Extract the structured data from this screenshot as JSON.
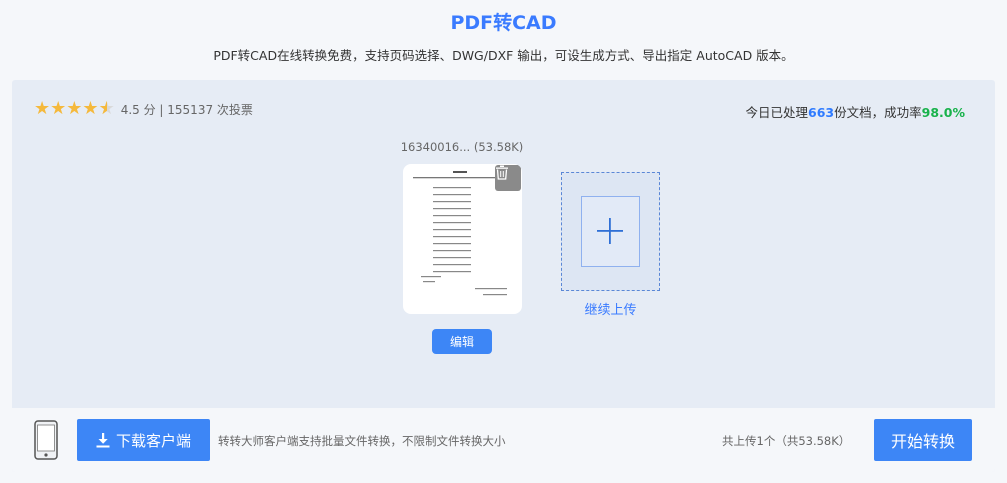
{
  "header": {
    "title": "PDF转CAD",
    "subtitle": "PDF转CAD在线转换免费，支持页码选择、DWG/DXF 输出，可设生成方式、导出指定 AutoCAD 版本。"
  },
  "rating": {
    "stars": 4.5,
    "text": "4.5 分 | 155137 次投票"
  },
  "stats": {
    "prefix": "今日已处理",
    "count": "663",
    "mid": "份文档，成功率",
    "rate": "98.0%"
  },
  "file": {
    "name": "16340016...",
    "size": "(53.58K)",
    "edit_label": "编辑",
    "delete_icon": "trash-icon"
  },
  "upload": {
    "label": "继续上传",
    "icon": "plus-icon"
  },
  "footer": {
    "download_label": "下载客户端",
    "note": "转转大师客户端支持批量文件转换，不限制文件转换大小",
    "upload_count": "共上传1个（共53.58K）",
    "start_label": "开始转换"
  },
  "colors": {
    "accent": "#3d86f6",
    "title": "#3a7bff",
    "success": "#18b24b",
    "star": "#f5b93c"
  }
}
